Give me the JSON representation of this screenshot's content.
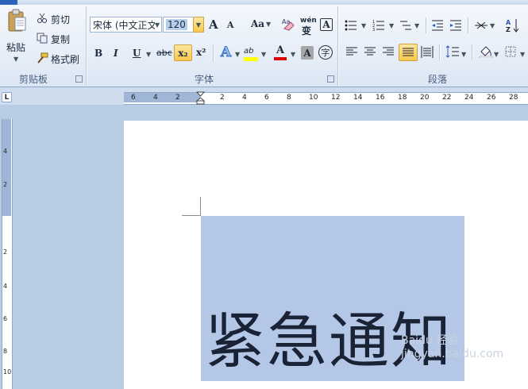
{
  "ribbon": {
    "clipboard": {
      "paste_label": "粘贴",
      "cut_label": "剪切",
      "copy_label": "复制",
      "format_painter_label": "格式刷",
      "group_label": "剪贴板"
    },
    "font": {
      "font_name": "宋体 (中文正文",
      "font_size": "120",
      "grow_label": "A",
      "shrink_label": "A",
      "case_label": "Aa",
      "phonetic_label": "wén",
      "border_char_label": "A",
      "bold_label": "B",
      "italic_label": "I",
      "underline_label": "U",
      "strike_label": "abc",
      "subscript_label": "x₂",
      "superscript_label": "x²",
      "effects_label": "A",
      "highlight_label": "ab",
      "font_color_label": "A",
      "shading_label": "A",
      "enclose_label": "字",
      "group_label": "字体"
    },
    "paragraph": {
      "group_label": "段落"
    }
  },
  "ruler": {
    "horizontal_ticks": [
      "6",
      "4",
      "2",
      "2",
      "4",
      "6",
      "8",
      "10",
      "12",
      "14",
      "16",
      "18",
      "20",
      "22",
      "24",
      "26",
      "28"
    ],
    "vertical_ticks": [
      "4",
      "2",
      "2",
      "4",
      "6",
      "8",
      "10"
    ],
    "tab_selector": "L"
  },
  "document": {
    "text": "紧急通知"
  },
  "watermark": "Baidu 经验  jingyan.baidu.com",
  "colors": {
    "selection": "#b4c7e7",
    "highlight_yellow": "#ffff00",
    "font_red": "#e00000",
    "active_button": "#f8c84e"
  }
}
